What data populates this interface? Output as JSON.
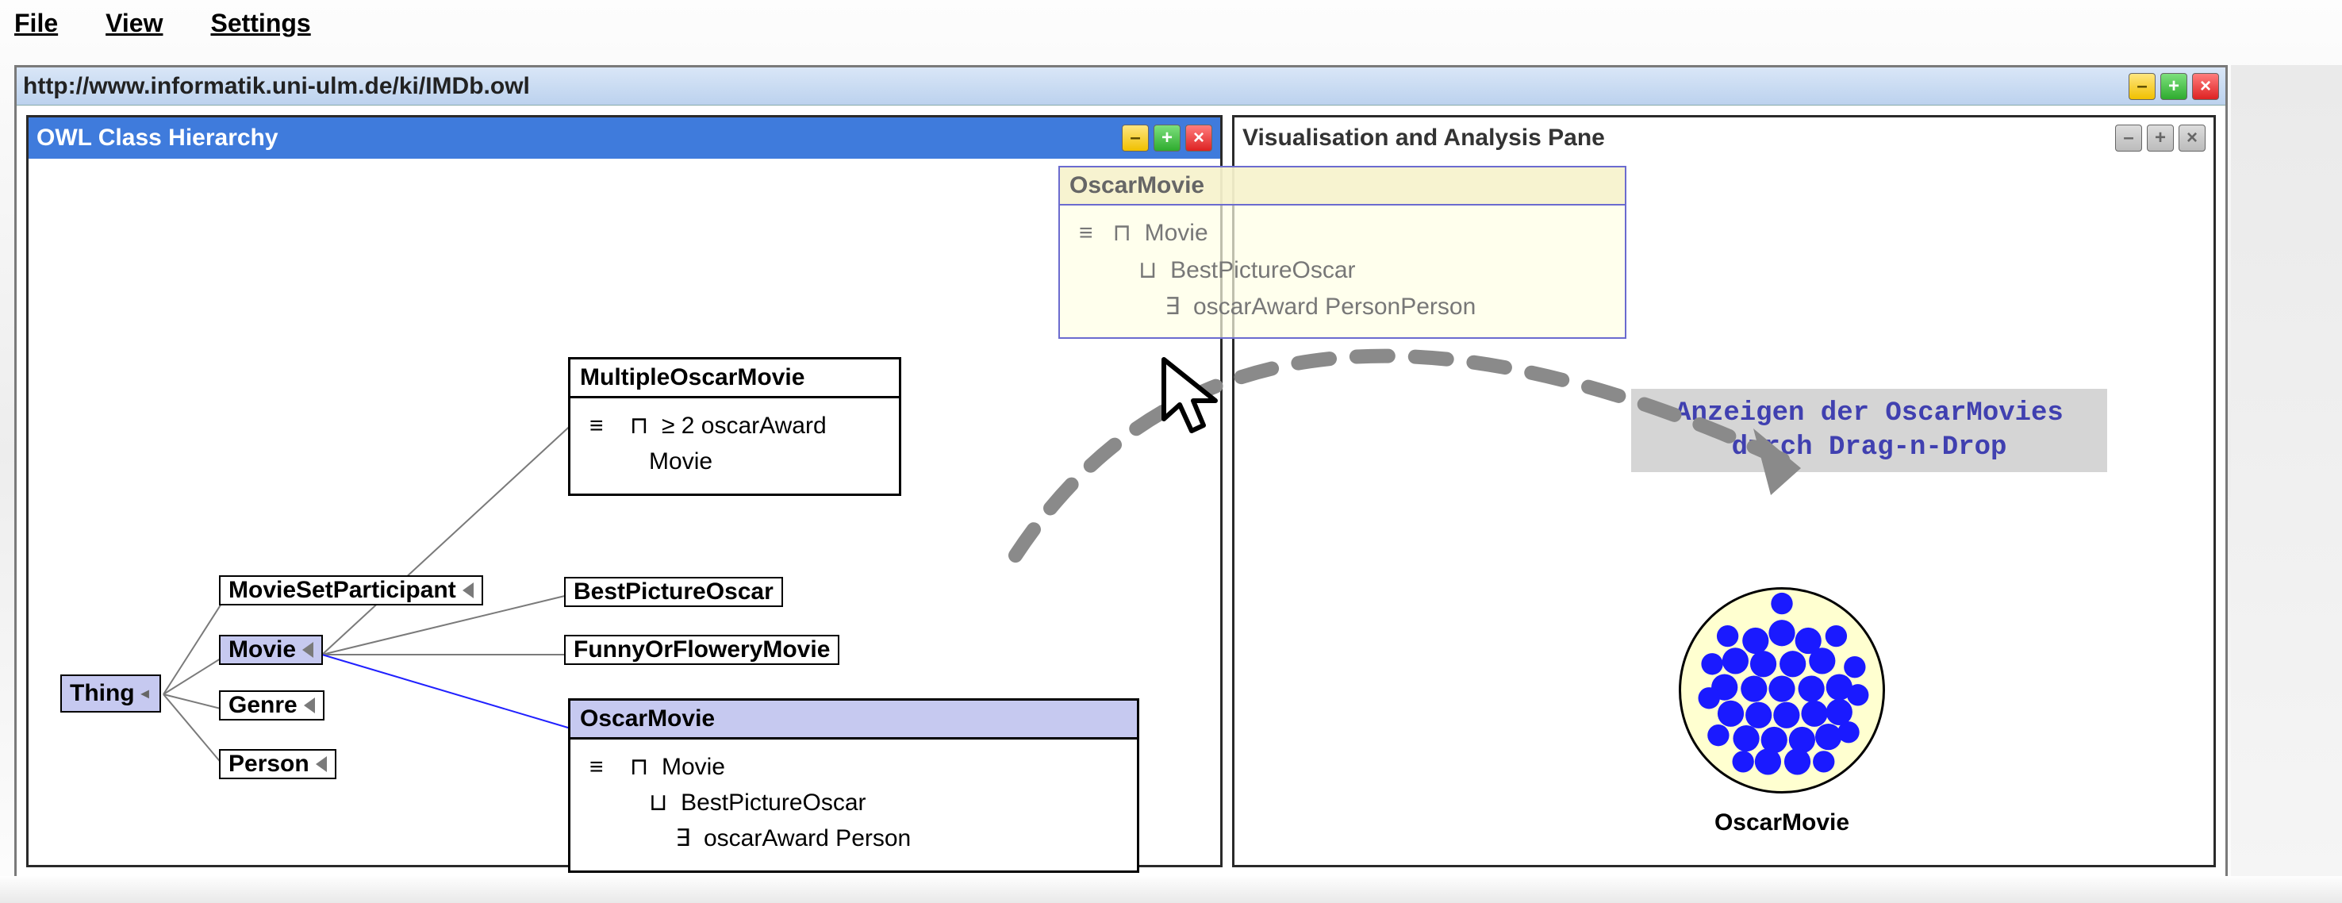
{
  "menubar": {
    "file": "File",
    "view": "View",
    "settings": "Settings"
  },
  "window": {
    "title": "http://www.informatik.uni-ulm.de/ki/IMDb.owl"
  },
  "left_pane": {
    "title": "OWL Class Hierarchy",
    "nodes": {
      "thing": "Thing",
      "mspart": "MovieSetParticipant",
      "movie": "Movie",
      "genre": "Genre",
      "person": "Person",
      "bpo": "BestPictureOscar",
      "fof": "FunnyOrFloweryMovie"
    },
    "defs": {
      "multipleOscarMovie": {
        "head": "MultipleOscarMovie",
        "equiv": "≡",
        "line1_sym": "⊓",
        "line1": "≥ 2 oscarAward",
        "line2": "Movie"
      },
      "oscarMovie": {
        "head": "OscarMovie",
        "equiv": "≡",
        "l1_sym": "⊓",
        "l1": "Movie",
        "l2_sym": "⊔",
        "l2": "BestPictureOscar",
        "l3_sym": "∃",
        "l3": "oscarAward Person"
      }
    }
  },
  "right_pane": {
    "title": "Visualisation and Analysis Pane",
    "viz_label": "OscarMovie",
    "annotation_line1": "Anzeigen der OscarMovies",
    "annotation_line2": "durch Drag-n-Drop"
  },
  "ghost": {
    "head": "OscarMovie",
    "equiv": "≡",
    "l1_sym": "⊓",
    "l1": "Movie",
    "l2_sym": "⊔",
    "l2": "BestPictureOscar",
    "l3_sym": "∃",
    "l3": "oscarAward PersonPerson"
  }
}
